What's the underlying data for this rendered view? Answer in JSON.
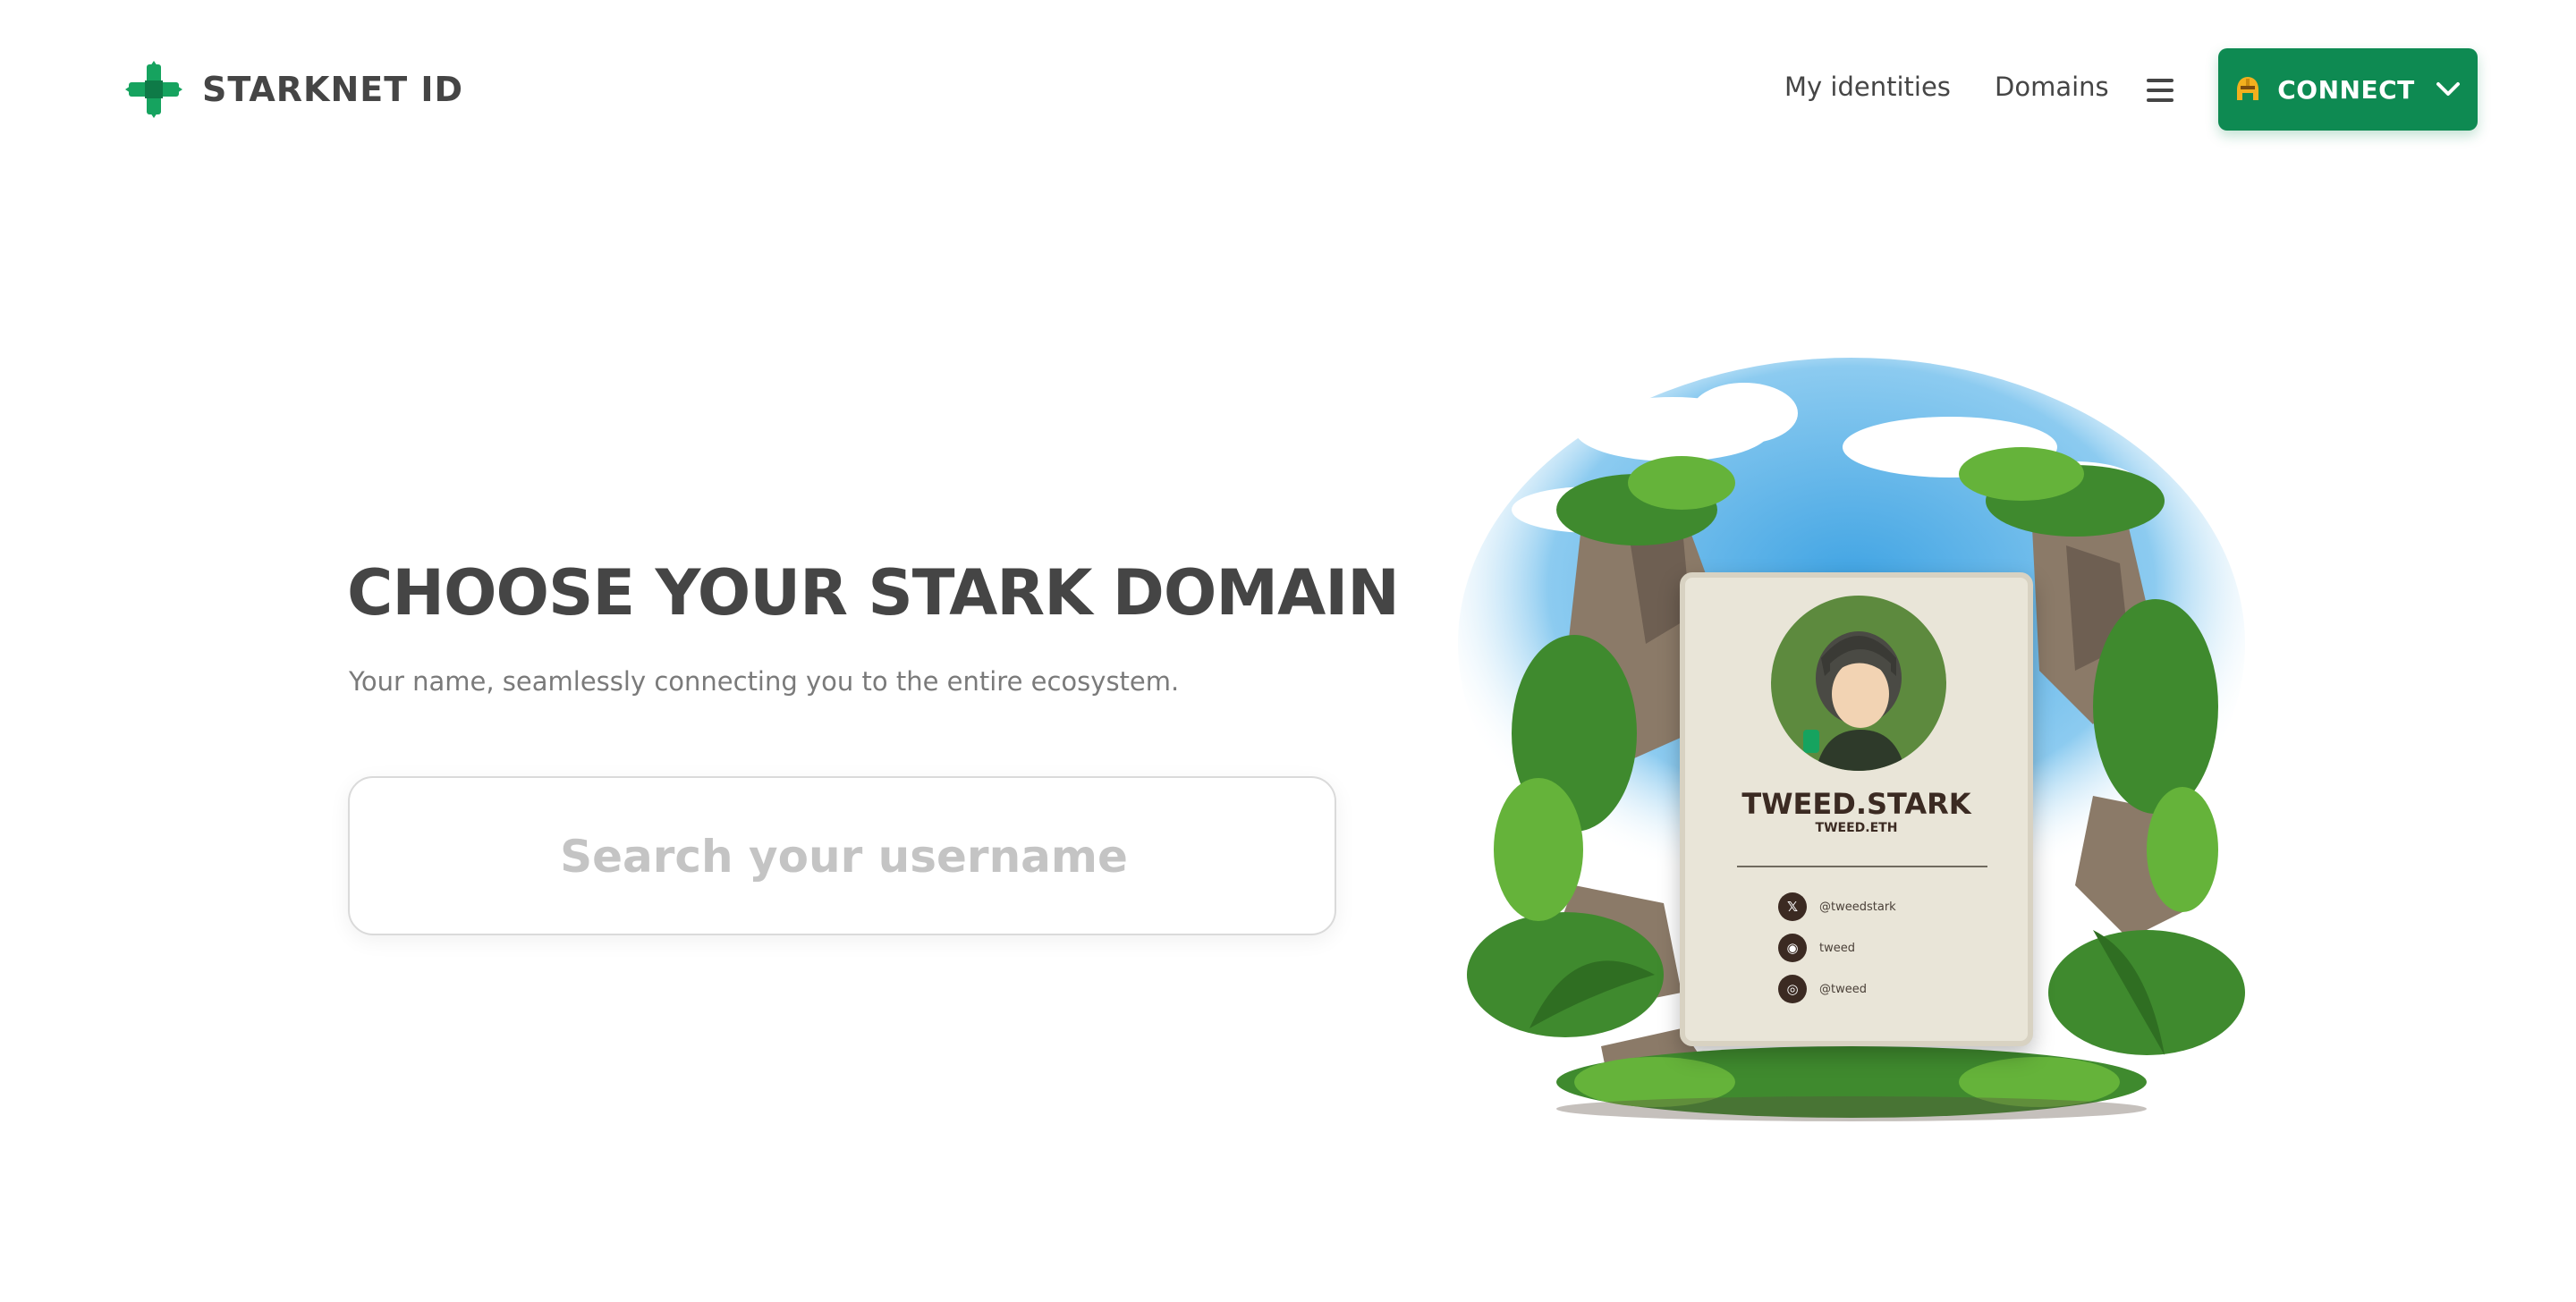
{
  "nav": {
    "brand": "STARKNET ID",
    "links": [
      "My identities",
      "Domains"
    ],
    "connect_label": "CONNECT"
  },
  "hero": {
    "title": "CHOOSE YOUR STARK DOMAIN",
    "subtitle": "Your name, seamlessly connecting you to the entire ecosystem.",
    "search_placeholder": "Search your username"
  },
  "card": {
    "name": "TWEED.STARK",
    "sub": "TWEED.ETH",
    "socials": [
      {
        "icon": "x-icon",
        "glyph": "𝕏",
        "handle": "@tweedstark"
      },
      {
        "icon": "github-icon",
        "glyph": "◉",
        "handle": "tweed"
      },
      {
        "icon": "discord-icon",
        "glyph": "◎",
        "handle": "@tweed"
      }
    ]
  },
  "colors": {
    "brand_green": "#0e8a52",
    "text_dark": "#454545",
    "text_muted": "#7a7a7a",
    "placeholder": "#c4c4c4"
  }
}
